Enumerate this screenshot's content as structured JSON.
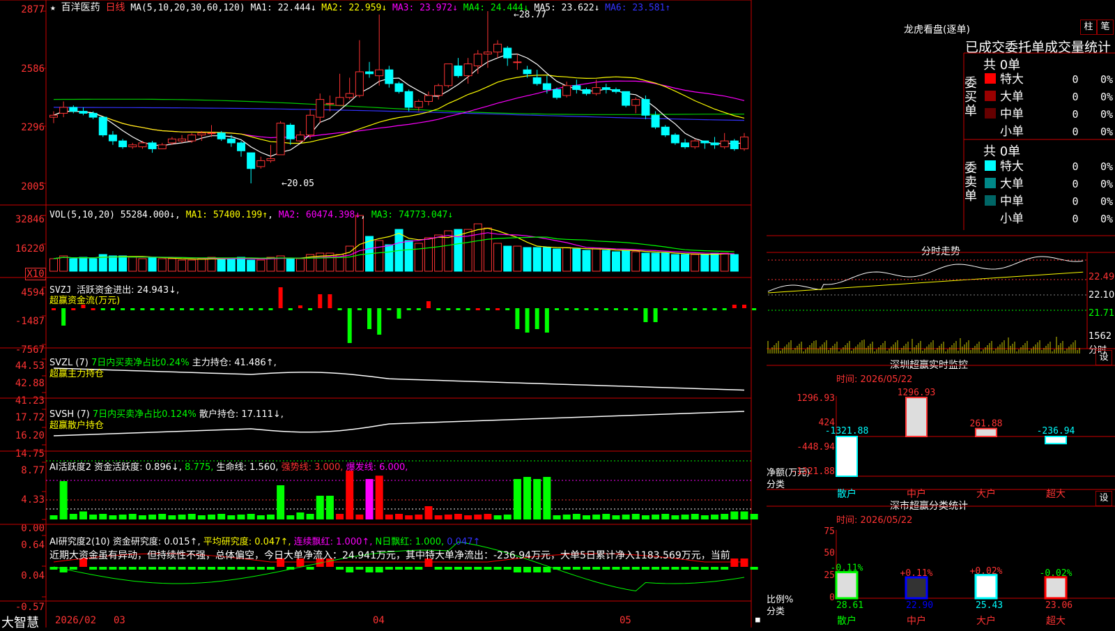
{
  "stock": {
    "name": "百洋医药",
    "period": "日线",
    "star": "★",
    "ma_header": "MA(5,10,20,30,60,120)",
    "ma": [
      {
        "label": "MA1:",
        "value": "22.444↓",
        "color": "#ffffff"
      },
      {
        "label": "MA2:",
        "value": "22.959↓",
        "color": "#ffff00"
      },
      {
        "label": "MA3:",
        "value": "23.972↓",
        "color": "#ff00ff"
      },
      {
        "label": "MA4:",
        "value": "24.444↓",
        "color": "#00ff00"
      },
      {
        "label": "MA5:",
        "value": "23.622↓",
        "color": "#ffffff"
      },
      {
        "label": "MA6:",
        "value": "23.581↑",
        "color": "#3333ff"
      }
    ],
    "y_labels": [
      "2877",
      "2586",
      "2296",
      "2005"
    ],
    "high_marker": "28.77",
    "low_marker": "20.05"
  },
  "vol": {
    "header": "VOL(5,10,20)",
    "value": "55284.000↓",
    "ma1": "MA1: 57400.199↑",
    "ma2": "MA2: 60474.398↓",
    "ma3": "MA3: 74773.047↓",
    "y_labels": [
      "32846",
      "16220"
    ],
    "unit": "X10"
  },
  "svzj": {
    "header": "SVZJ",
    "title": "活跃资金进出: 24.943↓,",
    "subtitle": "超赢资金流(万元)",
    "y_labels": [
      "4594",
      "-1487",
      "-7567"
    ]
  },
  "svzl": {
    "header": "SVZL (7)",
    "ratio": "7日内买卖净占比0.24%",
    "hold": "主力持仓: 41.486↑,",
    "subtitle": "超赢主力持仓",
    "y_labels": [
      "44.53",
      "42.88",
      "41.23"
    ]
  },
  "svsh": {
    "header": "SVSH (7)",
    "ratio": "7日内买卖净占比0.124%",
    "hold": "散户持仓: 17.111↓,",
    "subtitle": "超赢散户持仓",
    "y_labels": [
      "17.72",
      "16.20",
      "14.75"
    ]
  },
  "ai1": {
    "header": "AI活跃度2",
    "active": "资金活跃度: 0.896↓,",
    "v2": "8.775,",
    "life": "生命线: 1.560,",
    "strong": "强势线: 3.000,",
    "burst": "爆发线: 6.000,",
    "y_labels": [
      "8.77",
      "4.33",
      "0.00"
    ]
  },
  "ai2": {
    "header": "AI研究度2(10)",
    "research": "资金研究度: 0.015↑,",
    "avg": "平均研究度: 0.047↑,",
    "cont": "连续飘红: 1.000↑,",
    "nday": "N日飘红: 1.000,",
    "tail": "0.047↑",
    "note": "近期大资金虽有异动，但持续性不强，总体偏空，今日大单净流入：24.941万元，其中特大单净流出：-236.94万元，大单5日累计净入1183.569万元，当前",
    "y_labels": [
      "0.64",
      "0.04",
      "-0.57"
    ]
  },
  "footer": {
    "brand": "大智慧",
    "dates": [
      "2026/02",
      "03",
      "04",
      "05"
    ]
  },
  "dragon": {
    "title": "龙虎看盘(逐单)",
    "btn1": "柱",
    "btn2": "笔",
    "subtitle": "已成交委托单成交量统计",
    "buy_label": "委买单",
    "sell_label": "委卖单",
    "buy_total": "共 0单",
    "sell_total": "共 0单",
    "buy_rows": [
      {
        "name": "特大",
        "count": "0",
        "pct": "0%",
        "color": "#ff0000"
      },
      {
        "name": "大单",
        "count": "0",
        "pct": "0%",
        "color": "#990000"
      },
      {
        "name": "中单",
        "count": "0",
        "pct": "0%",
        "color": "#660000"
      },
      {
        "name": "小单",
        "count": "0",
        "pct": "0%",
        "color": "#000000"
      }
    ],
    "sell_rows": [
      {
        "name": "特大",
        "count": "0",
        "pct": "0%",
        "color": "#00ffff"
      },
      {
        "name": "大单",
        "count": "0",
        "pct": "0%",
        "color": "#008888"
      },
      {
        "name": "中单",
        "count": "0",
        "pct": "0%",
        "color": "#006666"
      },
      {
        "name": "小单",
        "count": "0",
        "pct": "0%",
        "color": "#000000"
      }
    ]
  },
  "intraday": {
    "title": "分时走势",
    "prices": [
      "22.49",
      "22.10",
      "21.71"
    ],
    "vol": "1562",
    "unit": "分时"
  },
  "monitor": {
    "title": "深圳超赢实时监控",
    "btn": "设",
    "time": "时间: 2026/05/22",
    "y_labels": [
      "1296.93",
      "424",
      "-448.94",
      "-1321.88"
    ],
    "axis_label": "净额(万元)",
    "axis_label2": "分类",
    "cats": [
      "散户",
      "中户",
      "大户",
      "超大"
    ],
    "values": [
      "-1321.88",
      "1296.93",
      "261.88",
      "-236.94"
    ]
  },
  "stats": {
    "title": "深市超赢分类统计",
    "btn": "设",
    "time": "时间: 2026/05/22",
    "y_labels": [
      "75",
      "50",
      "25",
      "0"
    ],
    "axis_label": "比例%",
    "axis_label2": "分类",
    "cats": [
      "散户",
      "中户",
      "大户",
      "超大"
    ],
    "changes": [
      "-0.11%",
      "+0.11%",
      "+0.02%",
      "-0.02%"
    ],
    "values": [
      "28.61",
      "22.90",
      "25.43",
      "23.06"
    ]
  },
  "chart_data": {
    "type": "table",
    "candles": [
      [
        23.4,
        23.7,
        23.1,
        23.5
      ],
      [
        23.6,
        24.2,
        23.4,
        23.9
      ],
      [
        23.9,
        24.0,
        23.6,
        23.7
      ],
      [
        23.7,
        23.9,
        23.5,
        23.6
      ],
      [
        23.6,
        23.7,
        23.3,
        23.4
      ],
      [
        23.4,
        23.4,
        22.4,
        22.5
      ],
      [
        22.5,
        22.7,
        22.0,
        22.2
      ],
      [
        22.2,
        22.3,
        21.8,
        21.9
      ],
      [
        21.9,
        22.1,
        21.8,
        22.0
      ],
      [
        21.9,
        22.2,
        21.8,
        22.1
      ],
      [
        22.1,
        22.2,
        21.6,
        21.8
      ],
      [
        21.8,
        22.1,
        21.8,
        22.0
      ],
      [
        22.1,
        22.4,
        22.0,
        22.3
      ],
      [
        22.2,
        22.5,
        22.1,
        22.3
      ],
      [
        22.2,
        22.6,
        22.1,
        22.5
      ],
      [
        22.5,
        22.7,
        22.2,
        22.6
      ],
      [
        22.6,
        23.0,
        22.4,
        22.6
      ],
      [
        22.6,
        22.7,
        22.2,
        22.3
      ],
      [
        22.3,
        22.5,
        21.9,
        22.1
      ],
      [
        22.1,
        22.2,
        21.4,
        21.7
      ],
      [
        21.6,
        21.6,
        20.05,
        20.8
      ],
      [
        20.9,
        21.4,
        20.8,
        21.2
      ],
      [
        21.2,
        22.0,
        21.1,
        21.3
      ],
      [
        21.5,
        23.2,
        21.5,
        23.1
      ],
      [
        23.0,
        23.1,
        22.0,
        22.3
      ],
      [
        22.2,
        22.7,
        22.1,
        22.5
      ],
      [
        22.5,
        23.8,
        22.3,
        23.5
      ],
      [
        23.4,
        24.6,
        23.1,
        24.3
      ],
      [
        24.1,
        24.5,
        23.7,
        24.1
      ],
      [
        24.0,
        25.6,
        24.0,
        24.4
      ],
      [
        24.4,
        25.4,
        24.3,
        24.6
      ],
      [
        24.5,
        27.3,
        24.4,
        25.7
      ],
      [
        25.7,
        26.2,
        25.4,
        25.6
      ],
      [
        25.5,
        28.6,
        25.0,
        25.8
      ],
      [
        25.8,
        26.0,
        24.9,
        25.1
      ],
      [
        25.1,
        25.2,
        24.6,
        24.7
      ],
      [
        24.7,
        24.8,
        23.7,
        23.9
      ],
      [
        23.9,
        24.3,
        23.7,
        24.2
      ],
      [
        24.2,
        24.7,
        24.0,
        24.5
      ],
      [
        24.5,
        25.1,
        24.3,
        25.0
      ],
      [
        25.0,
        26.1,
        24.9,
        26.1
      ],
      [
        26.0,
        26.4,
        25.4,
        25.5
      ],
      [
        25.5,
        26.4,
        25.1,
        26.1
      ],
      [
        26.0,
        26.8,
        25.6,
        26.6
      ],
      [
        26.6,
        28.77,
        25.9,
        26.7
      ],
      [
        26.7,
        27.3,
        26.4,
        27.1
      ],
      [
        26.9,
        27.0,
        26.0,
        26.4
      ],
      [
        26.2,
        26.6,
        25.8,
        26.2
      ],
      [
        25.8,
        26.0,
        25.4,
        25.6
      ],
      [
        25.4,
        25.8,
        25.0,
        25.1
      ],
      [
        25.1,
        25.5,
        24.6,
        24.8
      ],
      [
        24.8,
        24.9,
        24.3,
        24.4
      ],
      [
        24.5,
        25.2,
        24.4,
        25.0
      ],
      [
        25.0,
        25.3,
        24.6,
        24.8
      ],
      [
        24.8,
        24.9,
        24.5,
        24.6
      ],
      [
        24.6,
        25.3,
        24.5,
        24.9
      ],
      [
        24.9,
        25.1,
        24.6,
        24.8
      ],
      [
        24.8,
        24.9,
        24.6,
        24.7
      ],
      [
        24.7,
        24.7,
        23.9,
        24.0
      ],
      [
        24.0,
        24.4,
        23.6,
        24.3
      ],
      [
        24.3,
        24.5,
        23.3,
        23.5
      ],
      [
        23.5,
        23.7,
        22.8,
        22.9
      ],
      [
        22.9,
        23.0,
        22.4,
        22.5
      ],
      [
        22.5,
        22.6,
        22.0,
        22.1
      ],
      [
        22.1,
        22.3,
        21.8,
        21.9
      ],
      [
        21.9,
        22.3,
        21.8,
        22.2
      ],
      [
        22.2,
        22.2,
        21.8,
        22.1
      ],
      [
        22.1,
        22.4,
        21.8,
        22.0
      ],
      [
        21.9,
        22.6,
        21.8,
        22.2
      ],
      [
        22.2,
        22.3,
        21.7,
        21.8
      ],
      [
        21.8,
        22.6,
        21.7,
        22.4
      ]
    ],
    "volume": [
      9,
      11,
      9,
      10,
      9,
      12,
      11,
      11,
      10,
      9,
      10,
      9,
      9,
      8,
      8,
      9,
      10,
      9,
      9,
      10,
      8,
      8,
      10,
      11,
      9,
      9,
      12,
      13,
      13,
      12,
      18,
      40,
      25,
      22,
      19,
      30,
      22,
      20,
      24,
      26,
      29,
      30,
      30,
      34,
      31,
      20,
      18,
      18,
      17,
      17,
      17,
      16,
      17,
      16,
      15,
      16,
      15,
      14,
      15,
      14,
      13,
      13,
      13,
      12,
      12,
      12,
      12,
      13,
      13,
      12
    ],
    "svzj": [
      0,
      -25,
      0,
      5,
      0,
      -3,
      -3,
      -3,
      -3,
      -3,
      -3,
      -3,
      -3,
      -3,
      -3,
      -3,
      -3,
      -3,
      -3,
      -3,
      -3,
      -3,
      -3,
      30,
      -3,
      4,
      -3,
      20,
      20,
      -3,
      -50,
      -3,
      -30,
      -38,
      -3,
      -15,
      -3,
      -3,
      10,
      -3,
      -3,
      -3,
      -3,
      0,
      -3,
      0,
      -3,
      -30,
      -35,
      -30,
      -35,
      -3,
      -3,
      -3,
      -3,
      -3,
      -3,
      -3,
      -3,
      -3,
      -20,
      -20,
      -3,
      -3,
      -3,
      -3,
      -3,
      -3,
      -3,
      5,
      5,
      -3
    ]
  }
}
